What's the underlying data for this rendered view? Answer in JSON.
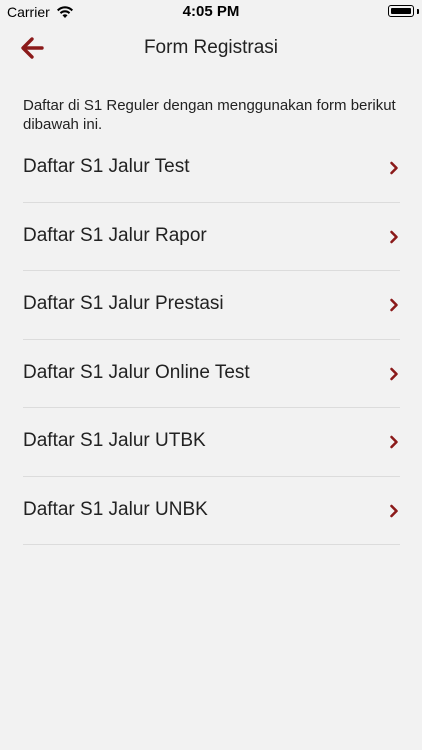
{
  "status_bar": {
    "carrier": "Carrier",
    "time": "4:05 PM"
  },
  "nav": {
    "title": "Form Registrasi",
    "accent_color": "#8b1a1a"
  },
  "intro": {
    "text": "Daftar di S1 Reguler dengan menggunakan form berikut dibawah ini."
  },
  "menu": {
    "items": [
      {
        "label": "Daftar S1 Jalur Test"
      },
      {
        "label": "Daftar S1 Jalur Rapor"
      },
      {
        "label": "Daftar S1 Jalur Prestasi"
      },
      {
        "label": "Daftar S1 Jalur Online Test"
      },
      {
        "label": "Daftar S1 Jalur UTBK"
      },
      {
        "label": "Daftar S1 Jalur UNBK"
      }
    ]
  }
}
